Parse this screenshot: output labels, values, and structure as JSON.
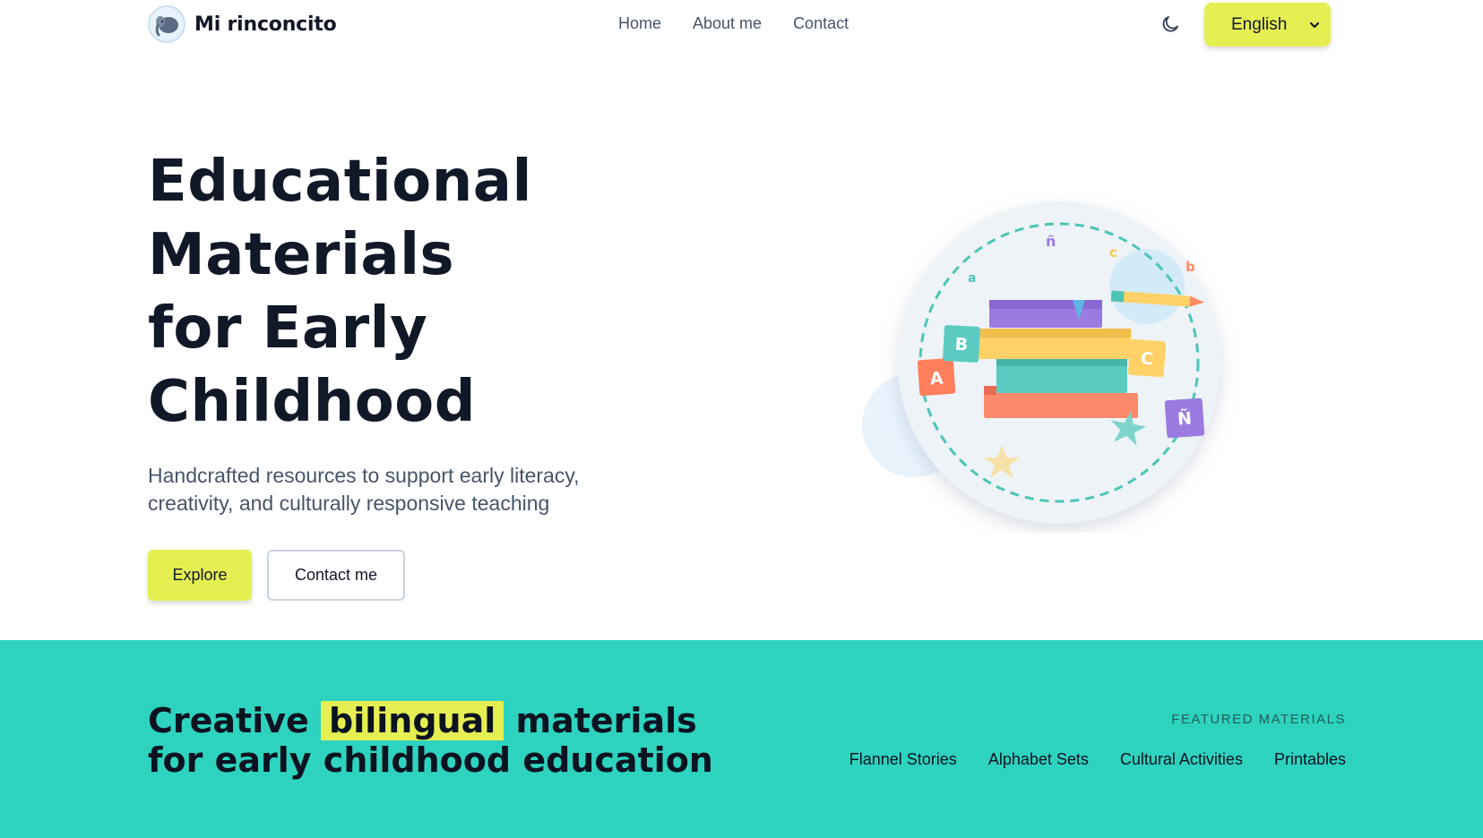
{
  "brand": {
    "name": "Mi rinconcito",
    "logo_icon": "elephant-icon"
  },
  "nav": {
    "home": "Home",
    "about": "About me",
    "contact": "Contact"
  },
  "header": {
    "theme_icon": "moon-icon",
    "language_selected": "English"
  },
  "hero": {
    "title_lines": [
      "Educational",
      "Materials",
      "for Early",
      "Childhood"
    ],
    "subtitle": "Handcrafted resources to support early literacy, creativity, and culturally responsive teaching",
    "explore_label": "Explore",
    "contact_label": "Contact me"
  },
  "illustration": {
    "letters_orbit": [
      "a",
      "ñ",
      "c",
      "b"
    ],
    "blocks": [
      "A",
      "B",
      "C",
      "Ñ"
    ]
  },
  "band": {
    "title_before": "Creative ",
    "title_highlight": "bilingual",
    "title_after": " materials for early childhood education",
    "featured_label": "FEATURED MATERIALS",
    "featured_items": [
      "Flannel Stories",
      "Alphabet Sets",
      "Cultural Activities",
      "Printables"
    ]
  },
  "colors": {
    "accent_yellow": "#e6ef52",
    "band_teal": "#2ed3bf",
    "text_dark": "#111827",
    "text_muted": "#475569"
  }
}
